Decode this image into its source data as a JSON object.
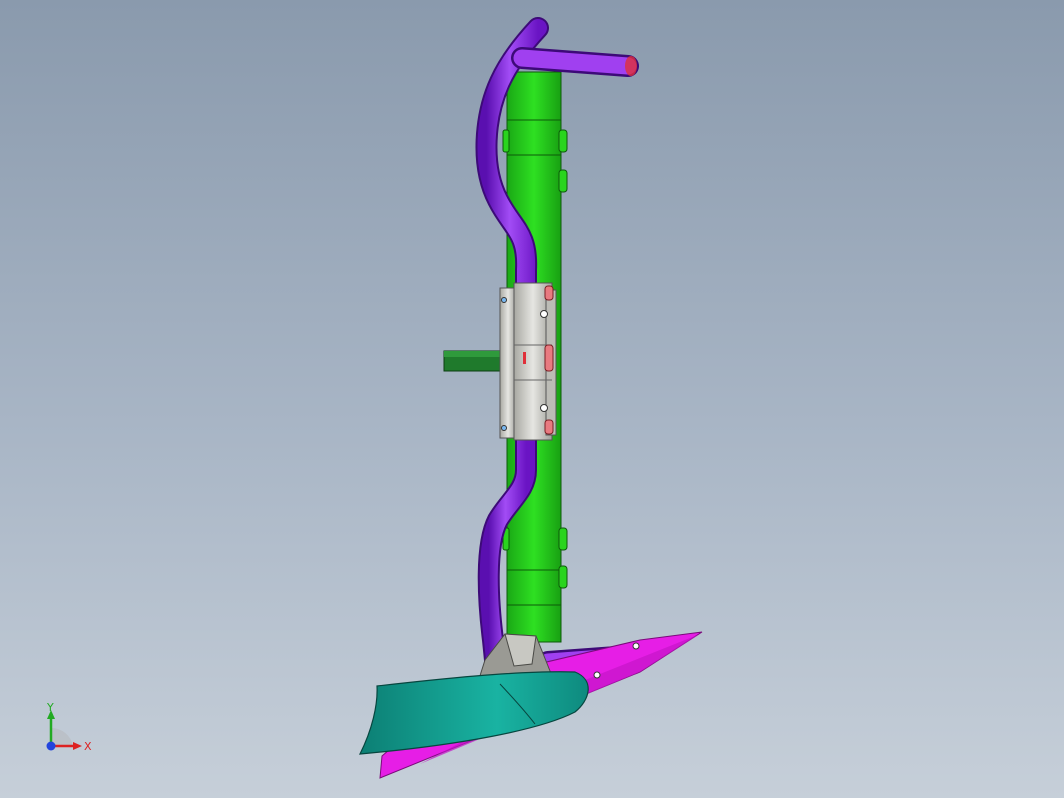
{
  "viewport": {
    "background_top": "#8a9aad",
    "background_bottom": "#c6cfd9"
  },
  "model": {
    "colors": {
      "frame_plate": "#22cc1a",
      "handle_tube": "#8a1ee6",
      "clamp": "#c8c8c4",
      "shaft": "#1f7a2c",
      "blade": "#139d8e",
      "fin": "#e61ee6",
      "bracket": "#9a9a94",
      "accent_red": "#e0303a"
    }
  },
  "triad": {
    "y_label": "Y",
    "x_label": "X",
    "y_color": "#22aa22",
    "x_color": "#dd2222",
    "z_color": "#2244dd"
  }
}
